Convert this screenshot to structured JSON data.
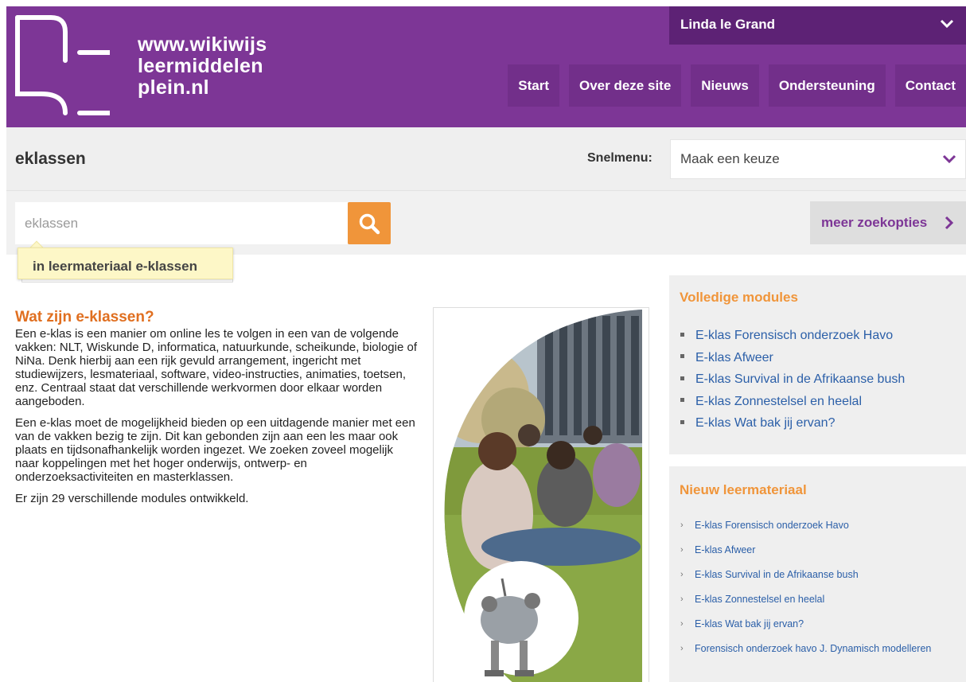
{
  "header": {
    "logo_lines": [
      "www.wikiwijs",
      "leermiddelen",
      "plein.nl"
    ],
    "user_name": "Linda le Grand",
    "nav": [
      "Start",
      "Over deze site",
      "Nieuws",
      "Ondersteuning",
      "Contact"
    ],
    "brand_color": "#7d3696"
  },
  "titlebar": {
    "title": "eklassen",
    "snelmenu_label": "Snelmenu:",
    "snelmenu_value": "Maak een keuze"
  },
  "search": {
    "placeholder": "eklassen",
    "more_label": "meer zoekopties",
    "suggestion": "in leermateriaal e-klassen",
    "button_color": "#f0953a"
  },
  "main": {
    "heading": "Wat zijn e-klassen?",
    "paragraphs": [
      "Een e-klas is een manier om online les te volgen in een van de volgende vakken: NLT, Wiskunde D, informatica, natuurkunde, scheikunde, biologie of NiNa. Denk hierbij aan een rijk gevuld arrangement, ingericht met studiewijzers, lesmateriaal, software, video-instructies, animaties, toetsen, enz. Centraal staat dat verschillende werkvormen door elkaar worden aangeboden.",
      "Een e-klas moet de mogelijkheid bieden op een uitdagende manier met een van de vakken bezig te zijn. Dit kan gebonden zijn aan een les maar ook plaats en tijdsonafhankelijk worden ingezet. We zoeken zoveel mogelijk naar koppelingen met het hoger onderwijs, ontwerp- en onderzoeksactiviteiten en masterklassen.",
      "Er zijn 29 verschillende modules ontwikkeld."
    ]
  },
  "sidebar": {
    "modules_title": "Volledige modules",
    "modules": [
      "E-klas Forensisch onderzoek Havo",
      "E-klas Afweer",
      "E-klas Survival in de Afrikaanse bush",
      "E-klas Zonnestelsel en heelal",
      "E-klas Wat bak jij ervan?"
    ],
    "new_title": "Nieuw leermateriaal",
    "new_items": [
      "E-klas Forensisch onderzoek Havo",
      "E-klas Afweer",
      "E-klas Survival in de Afrikaanse bush",
      "E-klas Zonnestelsel en heelal",
      "E-klas Wat bak jij ervan?",
      "Forensisch onderzoek havo J. Dynamisch modelleren"
    ]
  }
}
